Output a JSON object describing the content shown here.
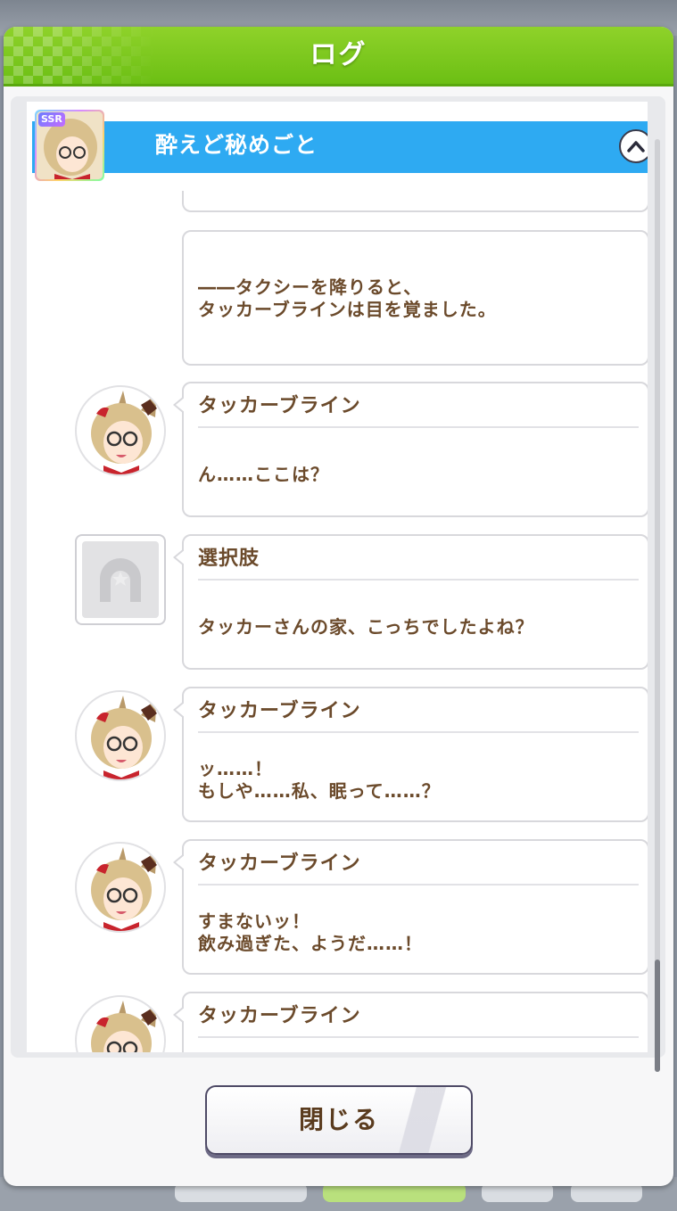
{
  "dialog": {
    "title": "ログ"
  },
  "chapter": {
    "title": "酔えど秘めごと",
    "badge": "SSR"
  },
  "entries": [
    {
      "type": "narration",
      "lines": [
        "――タクシーを降りると、",
        "タッカーブラインは目を覚ました。"
      ]
    },
    {
      "type": "speech",
      "speaker": "タッカーブライン",
      "lines": [
        "ん……ここは？"
      ]
    },
    {
      "type": "choice",
      "speaker": "選択肢",
      "lines": [
        "タッカーさんの家、こっちでしたよね？"
      ]
    },
    {
      "type": "speech",
      "speaker": "タッカーブライン",
      "lines": [
        "ッ……！",
        "もしや……私、眠って……？"
      ]
    },
    {
      "type": "speech",
      "speaker": "タッカーブライン",
      "lines": [
        "すまないッ！",
        "飲み過ぎた、ようだ……！"
      ]
    },
    {
      "type": "speech",
      "speaker": "タッカーブライン",
      "lines": []
    }
  ],
  "footer": {
    "close_label": "閉じる"
  }
}
